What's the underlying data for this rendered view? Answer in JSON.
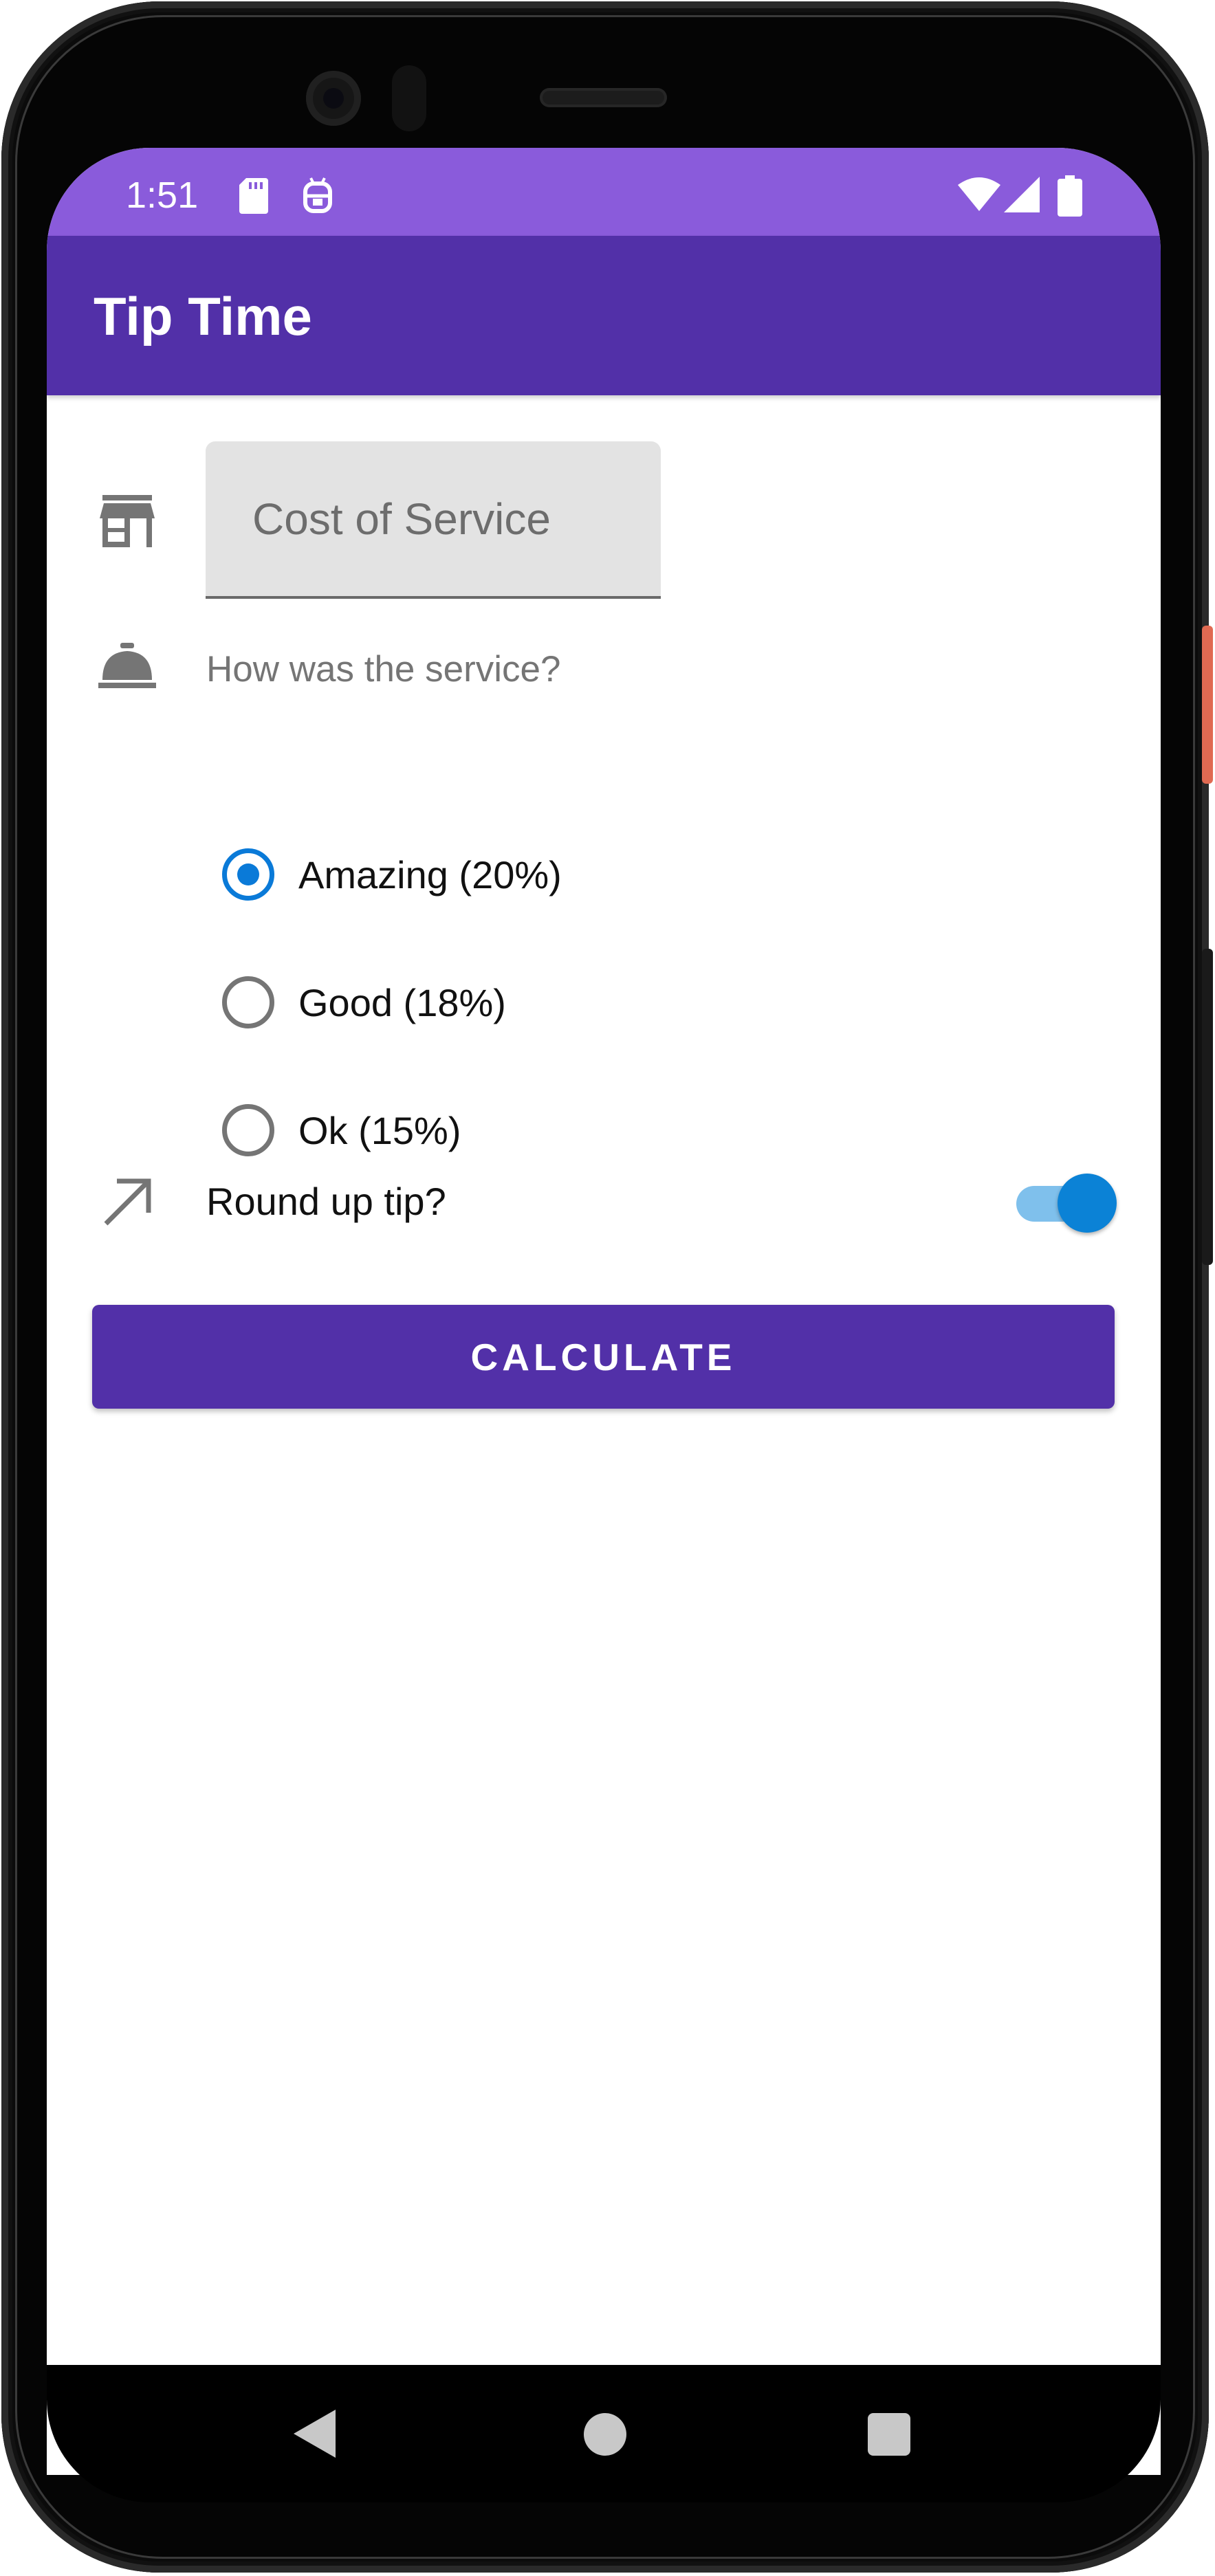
{
  "status_bar": {
    "time": "1:51",
    "icons": [
      "sd-card-icon",
      "android-debug-icon",
      "wifi-icon",
      "cell-signal-icon",
      "battery-icon"
    ]
  },
  "app_bar": {
    "title": "Tip Time"
  },
  "cost_field": {
    "placeholder": "Cost of Service",
    "value": "",
    "icon": "storefront-icon"
  },
  "service": {
    "question": "How was the service?",
    "icon": "room-service-bell-icon",
    "options": [
      {
        "label": "Amazing (20%)",
        "selected": true
      },
      {
        "label": "Good (18%)",
        "selected": false
      },
      {
        "label": "Ok (15%)",
        "selected": false
      }
    ]
  },
  "round_up": {
    "label": "Round up tip?",
    "icon": "trending-up-arrow-icon",
    "enabled": true
  },
  "calculate_button": {
    "label": "CALCULATE"
  },
  "colors": {
    "status_bar": "#8a5bdb",
    "app_bar": "#5230a8",
    "accent": "#0a7ad8",
    "button": "#5230a8"
  },
  "navigation": {
    "icons": [
      "back-icon",
      "home-icon",
      "recents-icon"
    ]
  }
}
